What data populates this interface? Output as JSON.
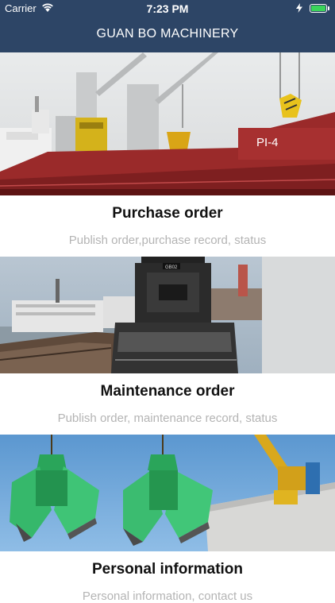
{
  "status_bar": {
    "carrier": "Carrier",
    "time": "7:23 PM",
    "battery_color": "#3ad35a"
  },
  "nav": {
    "title": "GUAN BO MACHINERY",
    "background": "#2d4566"
  },
  "cards": [
    {
      "title": "Purchase order",
      "subtitle": "Publish order,purchase record, status",
      "image": "cargo-ship-with-cranes-and-grab-buckets"
    },
    {
      "title": "Maintenance order",
      "subtitle": "Publish order, maintenance record, status",
      "image": "grab-bucket-over-bulk-carrier",
      "image_label": "GB02"
    },
    {
      "title": "Personal information",
      "subtitle": "Personal information, contact us",
      "image": "green-clamshell-grabs"
    }
  ],
  "ship_marking": "PI-4"
}
